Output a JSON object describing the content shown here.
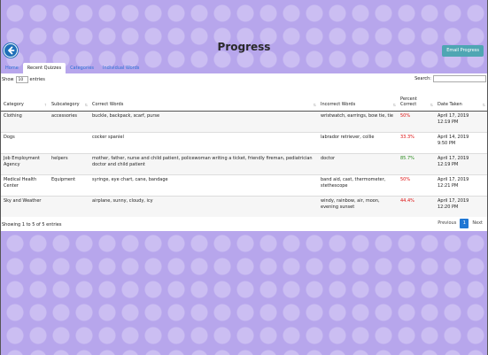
{
  "header": {
    "title": "Progress",
    "email_label": "Email Progress"
  },
  "tabs": [
    {
      "label": "Home"
    },
    {
      "label": "Recent Quizzes"
    },
    {
      "label": "Categories"
    },
    {
      "label": "Individual Words"
    }
  ],
  "controls": {
    "show_label": "Show",
    "length_value": "10",
    "entries_label": "entries",
    "search_label": "Search:"
  },
  "table": {
    "columns": [
      "Category",
      "Subcategory",
      "Correct Words",
      "Incorrect Words",
      "Percent Correct",
      "Date Taken"
    ],
    "rows": [
      {
        "category": "Clothing",
        "subcategory": "accessories",
        "correct": "buckle, backpack, scarf, purse",
        "incorrect": "wristwatch, earrings, bow tie, tie",
        "percent": "50%",
        "date": "April 17, 2019",
        "time": "12:19 PM"
      },
      {
        "category": "Dogs",
        "subcategory": "",
        "correct": "cocker spaniel",
        "incorrect": "labrador retriever, collie",
        "percent": "33.3%",
        "date": "April 14, 2019",
        "time": "9:50 PM"
      },
      {
        "category": "Job Employment Agency",
        "subcategory": "helpers",
        "correct": "mother, father, nurse and child patient, policewoman writing a ticket, friendly fireman, pediatrician doctor and child patient",
        "incorrect": "doctor",
        "percent": "85.7%",
        "date": "April 17, 2019",
        "time": "12:19 PM"
      },
      {
        "category": "Medical Health Center",
        "subcategory": "Equipment",
        "correct": "syringe, eye chart, cane, bandage",
        "incorrect": "band aid, cast, thermometer, stethescope",
        "percent": "50%",
        "date": "April 17, 2019",
        "time": "12:21 PM"
      },
      {
        "category": "Sky and Weather",
        "subcategory": "",
        "correct": "airplane, sunny, cloudy, icy",
        "incorrect": "windy, rainbow, air, moon, evening sunset",
        "percent": "44.4%",
        "date": "April 17, 2019",
        "time": "12:20 PM"
      }
    ]
  },
  "footer": {
    "info": "Showing 1 to 5 of 5 entries",
    "previous_label": "Previous",
    "current_page": "1",
    "next_label": "Next"
  },
  "colors": {
    "accent": "#1f77d4",
    "email_button": "#4fa6b3",
    "background": "#b7a6ec",
    "percent_low": "#dd1111",
    "percent_high": "#2a8a1e"
  }
}
